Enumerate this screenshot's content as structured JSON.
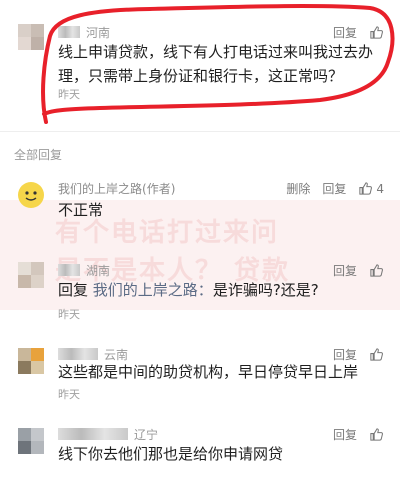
{
  "top_comment": {
    "username_partial": "河南",
    "reply_label": "回复",
    "text": "线上申请贷款，线下有人打电话过来叫我过去办理，只需带上身份证和银行卡，这正常吗？",
    "time": "昨天"
  },
  "section": {
    "label": "全部回复"
  },
  "replies": [
    {
      "author": "我们的上岸之路",
      "author_tag": "(作者)",
      "delete_label": "删除",
      "reply_label": "回复",
      "likes": "4",
      "text": "不正常",
      "time": ""
    },
    {
      "location": "湖南",
      "reply_label": "回复",
      "prefix": "回复",
      "reply_to": "我们的上岸之路：",
      "text": "是诈骗吗?还是?",
      "time": "昨天"
    },
    {
      "location": "云南",
      "reply_label": "回复",
      "text": "这些都是中间的助贷机构，早日停贷早日上岸",
      "time": "昨天"
    },
    {
      "location": "辽宁",
      "reply_label": "回复",
      "text": "线下你去他们那也是给你申请网贷",
      "time": ""
    }
  ],
  "watermark": {
    "line1": "有个电话打过来问",
    "line2": "是不是本人？ 贷款"
  },
  "colors": {
    "annotation": "#e8202a",
    "author_avatar": "#f6d64a"
  },
  "icons": {
    "like": "thumbs-up-icon"
  }
}
